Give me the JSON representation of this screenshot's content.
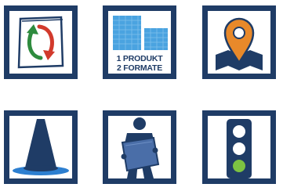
{
  "tiles": [
    {
      "icon": "exchange-arrows-icon"
    },
    {
      "icon": "two-formats-icon",
      "lines": [
        "1 PRODUKT",
        "2 FORMATE"
      ]
    },
    {
      "icon": "map-location-pin-icon"
    },
    {
      "icon": "traffic-cone-icon"
    },
    {
      "icon": "person-carrying-panel-icon"
    },
    {
      "icon": "traffic-light-icon"
    }
  ],
  "colors": {
    "frame": "#1f3c66",
    "accent_orange": "#e8892a",
    "arrow_green": "#2e8b3e",
    "arrow_red": "#d23a2c",
    "light_blue": "#4aa3e0",
    "signal_green": "#7dc242"
  }
}
